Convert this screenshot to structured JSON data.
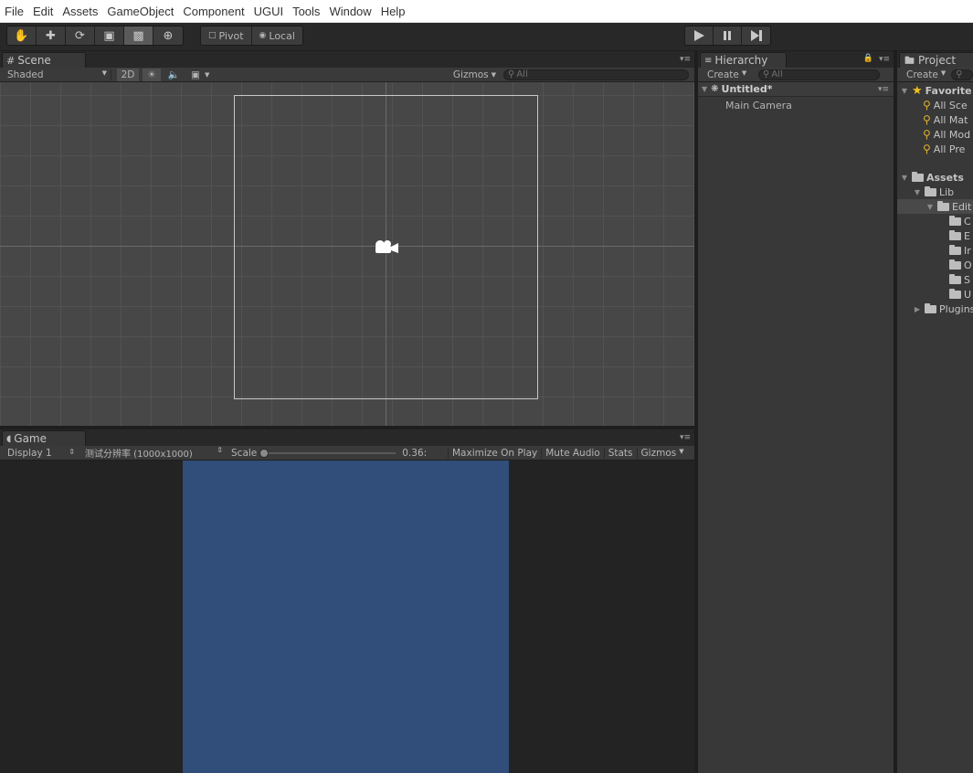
{
  "menubar": {
    "items": [
      "File",
      "Edit",
      "Assets",
      "GameObject",
      "Component",
      "UGUI",
      "Tools",
      "Window",
      "Help"
    ]
  },
  "toolbar": {
    "pivot_label": "Pivot",
    "local_label": "Local"
  },
  "scene": {
    "tab_label": "Scene",
    "shading_mode": "Shaded",
    "mode_2d": "2D",
    "gizmos_label": "Gizmos",
    "search_placeholder": "All"
  },
  "game": {
    "tab_label": "Game",
    "display": "Display 1",
    "resolution": "测试分辨率 (1000x1000)",
    "scale_label": "Scale",
    "scale_value": "0.36:",
    "maximize_label": "Maximize On Play",
    "mute_label": "Mute Audio",
    "stats_label": "Stats",
    "gizmos_label": "Gizmos",
    "canvas_color": "#314d79"
  },
  "hierarchy": {
    "tab_label": "Hierarchy",
    "create_label": "Create",
    "search_placeholder": "All",
    "scene_name": "Untitled*",
    "items": [
      "Main Camera"
    ]
  },
  "project": {
    "tab_label": "Project",
    "create_label": "Create",
    "favorites_label": "Favorite",
    "favorites": [
      "All Sce",
      "All Mat",
      "All Mod",
      "All Pre"
    ],
    "assets_label": "Assets",
    "lib_label": "Lib",
    "editor_label": "Edit",
    "editor_children": [
      "C",
      "E",
      "Ir",
      "O",
      "S",
      "U"
    ],
    "plugins_label": "Plugins"
  }
}
